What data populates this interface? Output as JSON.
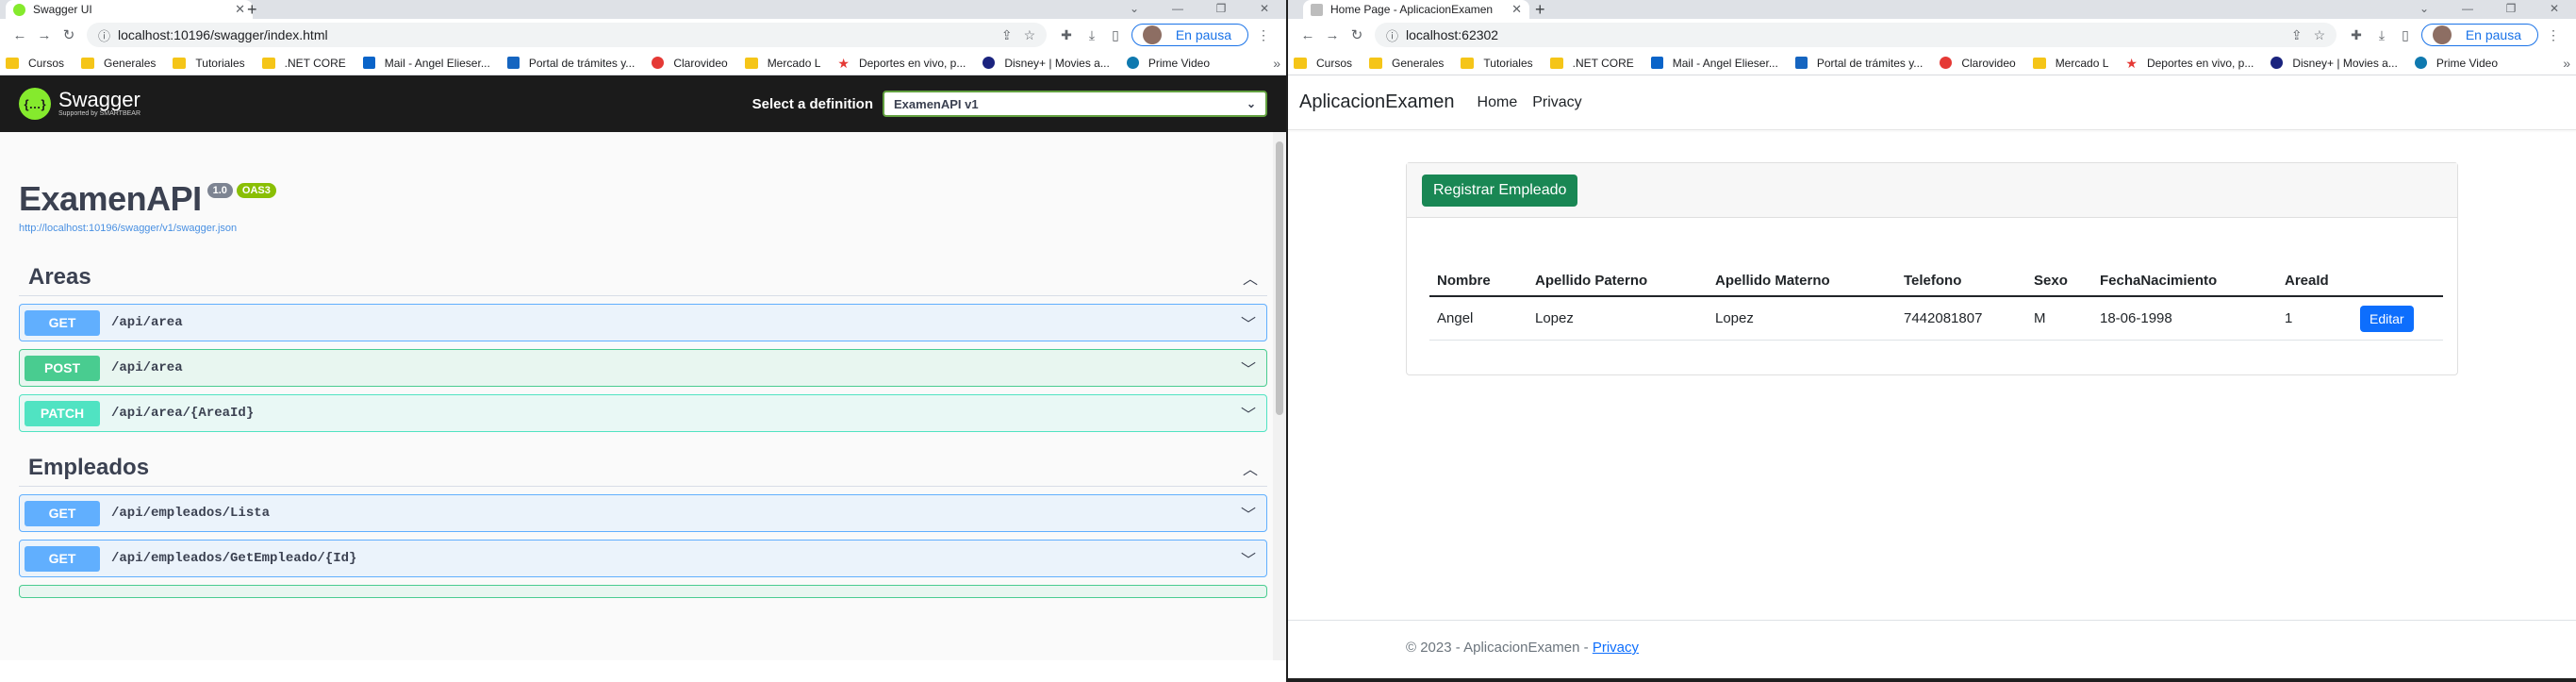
{
  "left": {
    "tab_title": "Swagger UI",
    "url": "localhost:10196/swagger/index.html",
    "bookmarks": [
      "Cursos",
      "Generales",
      "Tutoriales",
      ".NET CORE",
      "Mail - Angel Elieser...",
      "Portal de trámites y...",
      "Clarovideo",
      "Mercado L",
      "Deportes en vivo, p...",
      "Disney+ | Movies a...",
      "Prime Video"
    ],
    "paused_label": "En pausa",
    "swagger": {
      "brand": "Swagger",
      "brand_sub": "Supported by SMARTBEAR",
      "logo_glyph": "{…}",
      "definition_label": "Select a definition",
      "definition_value": "ExamenAPI v1",
      "api_title": "ExamenAPI",
      "version": "1.0",
      "oas": "OAS3",
      "spec_link": "http://localhost:10196/swagger/v1/swagger.json",
      "sections": [
        {
          "name": "Areas",
          "ops": [
            {
              "method": "GET",
              "path": "/api/area"
            },
            {
              "method": "POST",
              "path": "/api/area"
            },
            {
              "method": "PATCH",
              "path": "/api/area/{AreaId}"
            }
          ]
        },
        {
          "name": "Empleados",
          "ops": [
            {
              "method": "GET",
              "path": "/api/empleados/Lista"
            },
            {
              "method": "GET",
              "path": "/api/empleados/GetEmpleado/{Id}"
            }
          ]
        }
      ]
    }
  },
  "right": {
    "tab_title": "Home Page - AplicacionExamen",
    "url": "localhost:62302",
    "bookmarks": [
      "Cursos",
      "Generales",
      "Tutoriales",
      ".NET CORE",
      "Mail - Angel Elieser...",
      "Portal de trámites y...",
      "Clarovideo",
      "Mercado L",
      "Deportes en vivo, p...",
      "Disney+ | Movies a...",
      "Prime Video"
    ],
    "paused_label": "En pausa",
    "app": {
      "brand": "AplicacionExamen",
      "nav": [
        "Home",
        "Privacy"
      ],
      "register_button": "Registrar Empleado",
      "columns": [
        "Nombre",
        "Apellido Paterno",
        "Apellido Materno",
        "Telefono",
        "Sexo",
        "FechaNacimiento",
        "AreaId"
      ],
      "rows": [
        [
          "Angel",
          "Lopez",
          "Lopez",
          "7442081807",
          "M",
          "18-06-1998",
          "1"
        ]
      ],
      "edit_button": "Editar",
      "footer_text": "© 2023 - AplicacionExamen - ",
      "footer_link": "Privacy"
    }
  },
  "colors": {
    "get": "#61affe",
    "post": "#49cc90",
    "patch": "#50e3c2",
    "success": "#198754",
    "primary": "#0d6efd",
    "swagger_green": "#85ea2d"
  }
}
